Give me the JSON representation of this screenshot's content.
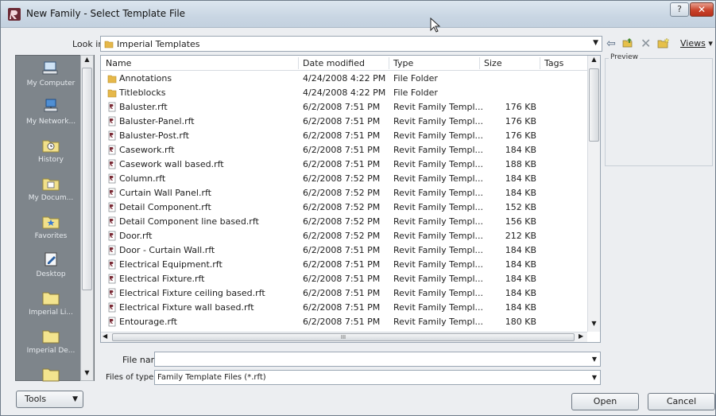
{
  "window": {
    "title": "New Family - Select Template File"
  },
  "titlebar_buttons": {
    "help": "?",
    "close": "✕"
  },
  "lookin": {
    "label": "Look in:",
    "value": "Imperial Templates"
  },
  "toolbar": {
    "views_label": "Views"
  },
  "places": [
    {
      "label": "My Computer",
      "icon": "computer-icon"
    },
    {
      "label": "My Network...",
      "icon": "network-icon"
    },
    {
      "label": "History",
      "icon": "history-icon"
    },
    {
      "label": "My Docum...",
      "icon": "documents-icon"
    },
    {
      "label": "Favorites",
      "icon": "favorites-icon"
    },
    {
      "label": "Desktop",
      "icon": "desktop-icon"
    },
    {
      "label": "Imperial Li...",
      "icon": "folder-icon"
    },
    {
      "label": "Imperial De...",
      "icon": "folder-icon"
    },
    {
      "label": "",
      "icon": "folder-icon"
    }
  ],
  "columns": {
    "name": "Name",
    "date": "Date modified",
    "type": "Type",
    "size": "Size",
    "tags": "Tags"
  },
  "files": [
    {
      "name": "Annotations",
      "date": "4/24/2008 4:22 PM",
      "type": "File Folder",
      "size": "",
      "kind": "folder"
    },
    {
      "name": "Titleblocks",
      "date": "4/24/2008 4:22 PM",
      "type": "File Folder",
      "size": "",
      "kind": "folder"
    },
    {
      "name": "Baluster.rft",
      "date": "6/2/2008 7:51 PM",
      "type": "Revit Family Templ...",
      "size": "176 KB",
      "kind": "file"
    },
    {
      "name": "Baluster-Panel.rft",
      "date": "6/2/2008 7:51 PM",
      "type": "Revit Family Templ...",
      "size": "176 KB",
      "kind": "file"
    },
    {
      "name": "Baluster-Post.rft",
      "date": "6/2/2008 7:51 PM",
      "type": "Revit Family Templ...",
      "size": "176 KB",
      "kind": "file"
    },
    {
      "name": "Casework.rft",
      "date": "6/2/2008 7:51 PM",
      "type": "Revit Family Templ...",
      "size": "184 KB",
      "kind": "file"
    },
    {
      "name": "Casework wall based.rft",
      "date": "6/2/2008 7:51 PM",
      "type": "Revit Family Templ...",
      "size": "188 KB",
      "kind": "file"
    },
    {
      "name": "Column.rft",
      "date": "6/2/2008 7:52 PM",
      "type": "Revit Family Templ...",
      "size": "184 KB",
      "kind": "file"
    },
    {
      "name": "Curtain Wall Panel.rft",
      "date": "6/2/2008 7:52 PM",
      "type": "Revit Family Templ...",
      "size": "184 KB",
      "kind": "file"
    },
    {
      "name": "Detail Component.rft",
      "date": "6/2/2008 7:52 PM",
      "type": "Revit Family Templ...",
      "size": "152 KB",
      "kind": "file"
    },
    {
      "name": "Detail Component line based.rft",
      "date": "6/2/2008 7:52 PM",
      "type": "Revit Family Templ...",
      "size": "156 KB",
      "kind": "file"
    },
    {
      "name": "Door.rft",
      "date": "6/2/2008 7:52 PM",
      "type": "Revit Family Templ...",
      "size": "212 KB",
      "kind": "file"
    },
    {
      "name": "Door - Curtain Wall.rft",
      "date": "6/2/2008 7:51 PM",
      "type": "Revit Family Templ...",
      "size": "184 KB",
      "kind": "file"
    },
    {
      "name": "Electrical Equipment.rft",
      "date": "6/2/2008 7:51 PM",
      "type": "Revit Family Templ...",
      "size": "184 KB",
      "kind": "file"
    },
    {
      "name": "Electrical Fixture.rft",
      "date": "6/2/2008 7:51 PM",
      "type": "Revit Family Templ...",
      "size": "184 KB",
      "kind": "file"
    },
    {
      "name": "Electrical Fixture ceiling based.rft",
      "date": "6/2/2008 7:51 PM",
      "type": "Revit Family Templ...",
      "size": "184 KB",
      "kind": "file"
    },
    {
      "name": "Electrical Fixture wall based.rft",
      "date": "6/2/2008 7:51 PM",
      "type": "Revit Family Templ...",
      "size": "184 KB",
      "kind": "file"
    },
    {
      "name": "Entourage.rft",
      "date": "6/2/2008 7:51 PM",
      "type": "Revit Family Templ...",
      "size": "180 KB",
      "kind": "file"
    }
  ],
  "hscroll_grip": "III",
  "preview": {
    "label": "Preview"
  },
  "filename": {
    "label": "File name:",
    "value": ""
  },
  "filetype": {
    "label": "Files of type:",
    "value": "Family Template Files  (*.rft)"
  },
  "buttons": {
    "tools": "Tools",
    "open": "Open",
    "cancel": "Cancel"
  }
}
